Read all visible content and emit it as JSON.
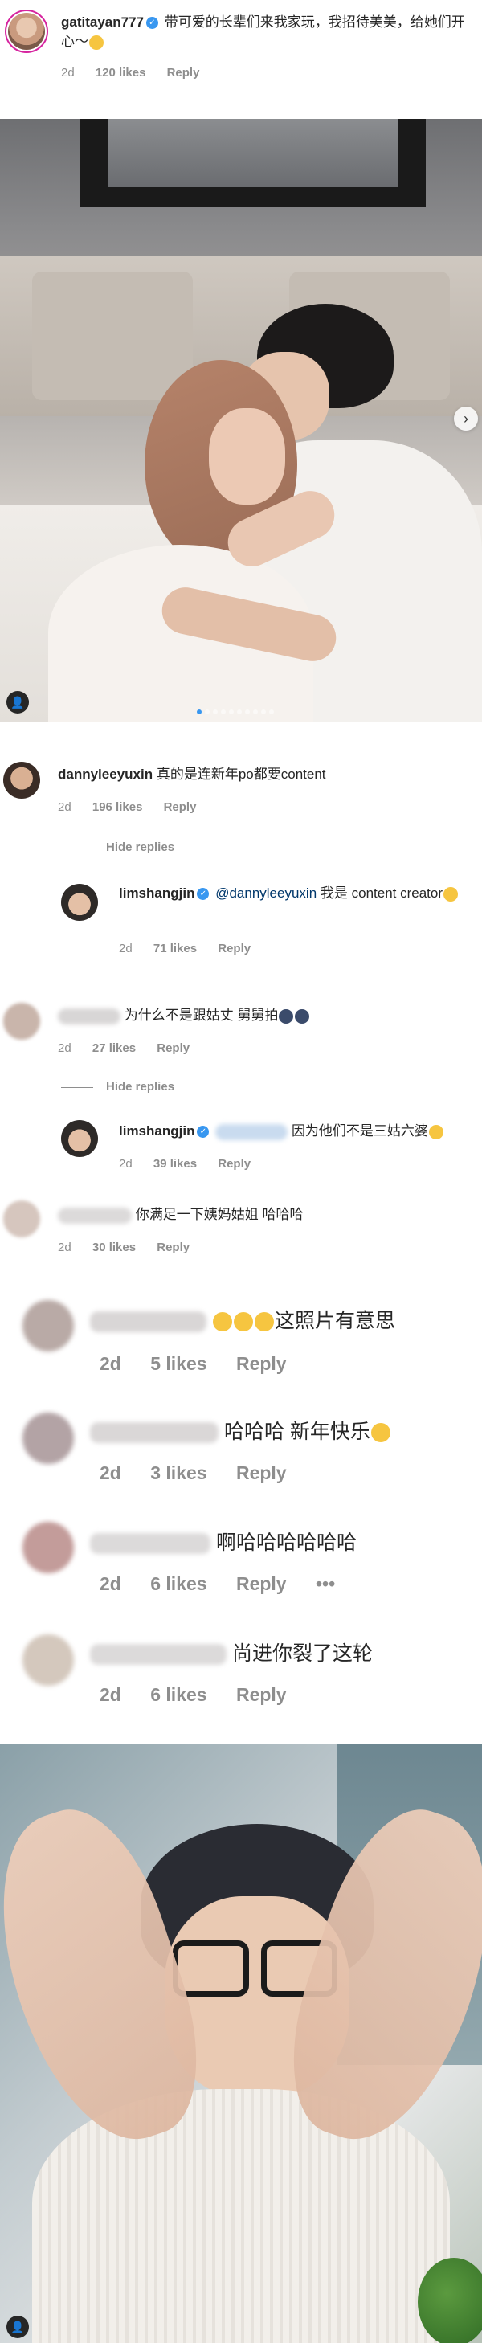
{
  "top_comment": {
    "username": "gatitayan777",
    "text": "带可爱的长辈们来我家玩，我招待美美，给她们开心～",
    "time": "2d",
    "likes": "120 likes",
    "reply": "Reply"
  },
  "photo1": {
    "carousel_dot_count": 10,
    "active_dot": 0
  },
  "comments": [
    {
      "username": "dannyleeyuxin",
      "text": "真的是连新年po都要content",
      "time": "2d",
      "likes": "196 likes",
      "reply": "Reply"
    }
  ],
  "hide_replies_label": "Hide replies",
  "reply1": {
    "username": "limshangjin",
    "mention": "@dannyleeyuxin",
    "text": "我是 content creator",
    "time": "2d",
    "likes": "71 likes",
    "reply": "Reply"
  },
  "comment2": {
    "text": "为什么不是跟姑丈 舅舅拍",
    "time": "2d",
    "likes": "27 likes",
    "reply": "Reply"
  },
  "reply2": {
    "username": "limshangjin",
    "text": "因为他们不是三姑六婆",
    "time": "2d",
    "likes": "39 likes",
    "reply": "Reply"
  },
  "comment3": {
    "text": "你满足一下姨妈姑姐 哈哈哈",
    "time": "2d",
    "likes": "30 likes",
    "reply": "Reply"
  },
  "big_comments": [
    {
      "text": "这照片有意思",
      "time": "2d",
      "likes": "5 likes",
      "reply": "Reply"
    },
    {
      "text": "哈哈哈 新年快乐",
      "time": "2d",
      "likes": "3 likes",
      "reply": "Reply"
    },
    {
      "text": "啊哈哈哈哈哈哈",
      "time": "2d",
      "likes": "6 likes",
      "reply": "Reply",
      "more": "•••"
    },
    {
      "text": "尚进你裂了这轮",
      "time": "2d",
      "likes": "6 likes",
      "reply": "Reply"
    }
  ],
  "colors": {
    "verified": "#3897f0",
    "meta": "#8e8e8e",
    "text": "#262626",
    "mention": "#00376b"
  }
}
